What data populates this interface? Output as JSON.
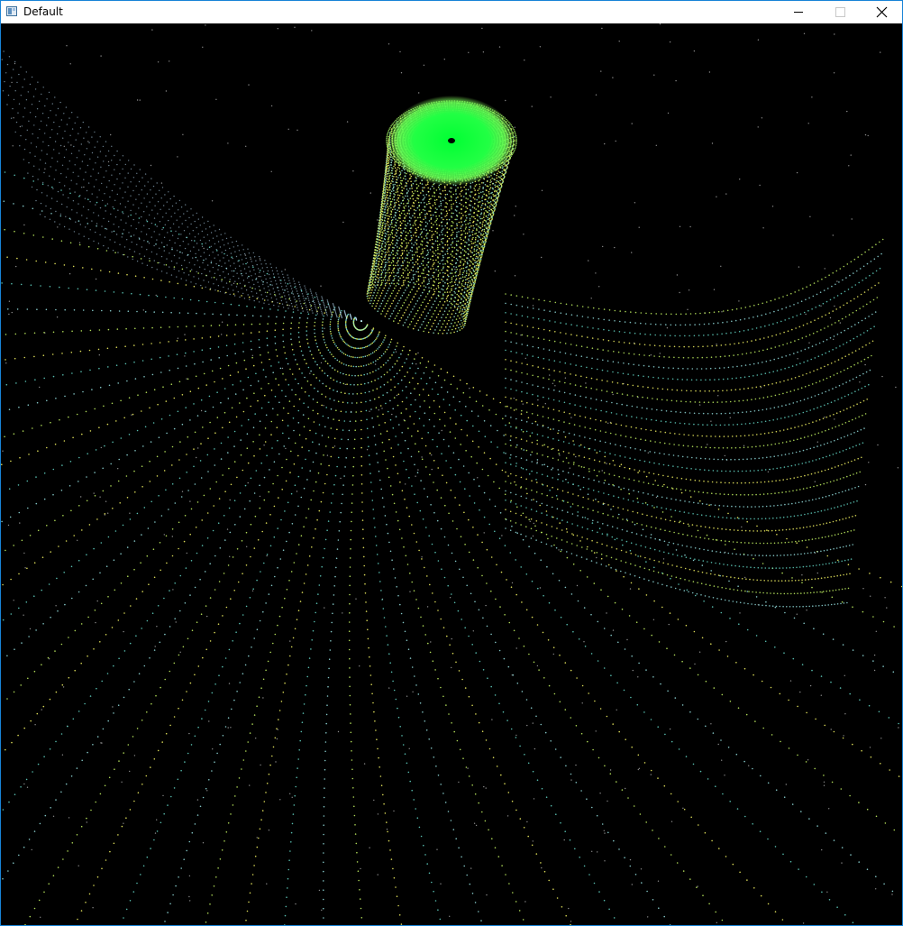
{
  "window": {
    "title": "Default",
    "icon": "application-window-icon",
    "controls": [
      {
        "name": "minimize-button",
        "icon": "minimize-icon"
      },
      {
        "name": "maximize-button",
        "icon": "maximize-icon",
        "state": "disabled"
      },
      {
        "name": "close-button",
        "icon": "close-icon"
      }
    ]
  },
  "scene": {
    "description_type": "dotted-field-visualization",
    "background_color": "#000000",
    "peak_color": "#22ff44",
    "line_colors": [
      "#ffff66",
      "#ccff66",
      "#99e6e6",
      "#66ddcc"
    ],
    "center_marker_color": "#000000"
  }
}
